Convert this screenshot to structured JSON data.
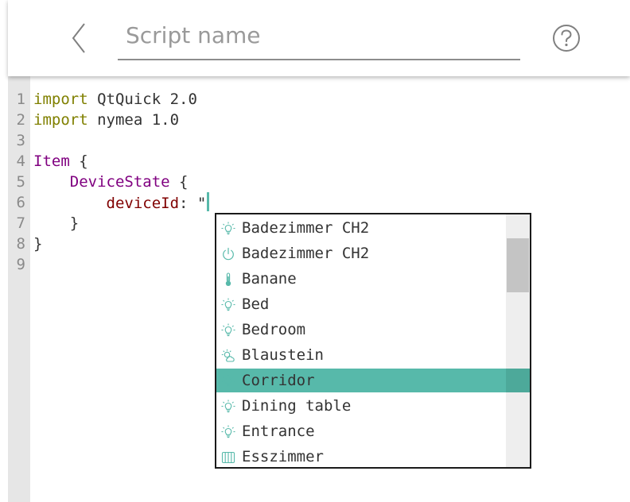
{
  "header": {
    "name_placeholder": "Script name",
    "name_value": "",
    "back_icon": "chevron-left-icon",
    "help_icon": "help-circle-icon"
  },
  "editor": {
    "lines": [
      {
        "num": "1",
        "segments": [
          {
            "t": "import",
            "c": "kw"
          },
          {
            "t": " QtQuick 2.0",
            "c": "plain"
          }
        ]
      },
      {
        "num": "2",
        "segments": [
          {
            "t": "import",
            "c": "kw"
          },
          {
            "t": " nymea 1.0",
            "c": "plain"
          }
        ]
      },
      {
        "num": "3",
        "segments": []
      },
      {
        "num": "4",
        "segments": [
          {
            "t": "Item",
            "c": "type"
          },
          {
            "t": " {",
            "c": "plain"
          }
        ]
      },
      {
        "num": "5",
        "segments": [
          {
            "t": "    ",
            "c": "plain"
          },
          {
            "t": "DeviceState",
            "c": "type"
          },
          {
            "t": " {",
            "c": "plain"
          }
        ]
      },
      {
        "num": "6",
        "segments": [
          {
            "t": "        ",
            "c": "plain"
          },
          {
            "t": "deviceId",
            "c": "prop"
          },
          {
            "t": ": \"",
            "c": "plain"
          }
        ],
        "caret": true
      },
      {
        "num": "7",
        "segments": [
          {
            "t": "    }",
            "c": "plain"
          }
        ]
      },
      {
        "num": "8",
        "segments": [
          {
            "t": "}",
            "c": "plain"
          }
        ]
      },
      {
        "num": "9",
        "segments": []
      }
    ]
  },
  "completion": {
    "selected_index": 6,
    "items": [
      {
        "label": "Badezimmer CH2",
        "icon": "light-bulb-icon"
      },
      {
        "label": "Badezimmer CH2",
        "icon": "power-icon"
      },
      {
        "label": "Banane",
        "icon": "thermometer-icon"
      },
      {
        "label": "Bed",
        "icon": "light-bulb-icon"
      },
      {
        "label": "Bedroom",
        "icon": "light-bulb-icon"
      },
      {
        "label": "Blaustein",
        "icon": "weather-icon"
      },
      {
        "label": "Corridor",
        "icon": "light-bulb-icon"
      },
      {
        "label": "Dining table",
        "icon": "light-bulb-icon"
      },
      {
        "label": "Entrance",
        "icon": "light-bulb-icon"
      },
      {
        "label": "Esszimmer",
        "icon": "radiator-icon"
      }
    ],
    "colors": {
      "selection": "#57b9aa",
      "icon": "#57b9aa"
    }
  }
}
